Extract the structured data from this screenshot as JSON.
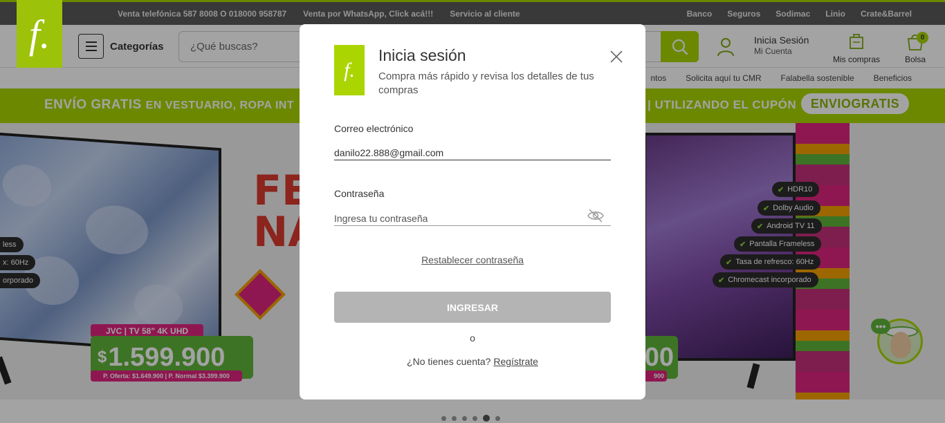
{
  "topbar": {
    "left_links": [
      "Venta telefónica 587 8008 O 018000 958787",
      "Venta por WhatsApp, Click acá!!!",
      "Servicio al cliente"
    ],
    "right_links": [
      "Banco",
      "Seguros",
      "Sodimac",
      "Linio",
      "Crate&Barrel"
    ]
  },
  "logo": {
    "glyph": "f."
  },
  "header": {
    "categories_label": "Categorías",
    "search_placeholder": "¿Qué buscas?",
    "user_title": "Inicia Sesión",
    "user_subtitle": "Mi Cuenta",
    "orders_label": "Mis compras",
    "bag_label": "Bolsa",
    "bag_count": "0"
  },
  "subnav": {
    "items": [
      "ntos",
      "Solicita aquí tu CMR",
      "Falabella sostenible",
      "Beneficios"
    ]
  },
  "promo": {
    "left_bold": "ENVÍO GRATIS",
    "left_rest": "EN VESTUARIO, ROPA INT",
    "right_text": "| UTILIZANDO EL CUPÓN",
    "coupon": "ENVIOGRATIS"
  },
  "banner": {
    "left_badges": [
      "less",
      "x: 60Hz",
      "orporado"
    ],
    "left_product": "JVC | TV 58\" 4K UHD",
    "left_price_symbol": "$",
    "left_price": "1.599.900",
    "left_offer": "P. Oferta: $1.649.900 | P. Normal $3.399.900",
    "feria_letters": [
      "FE",
      "NA"
    ],
    "right_badges": [
      "HDR10",
      "Dolby Audio",
      "Android TV 11",
      "Pantalla Frameless",
      "Tasa de refresco: 60Hz",
      "Chromecast incorporado"
    ],
    "right_price": "00",
    "right_offer": "900",
    "check_glyph": "✔",
    "chat_glyph": "•••"
  },
  "carousel": {
    "count": 6,
    "active": 5
  },
  "modal": {
    "logo_glyph": "f.",
    "title": "Inicia sesión",
    "subtitle": "Compra más rápido y revisa los detalles de tus compras",
    "email_label": "Correo electrónico",
    "email_value": "danilo22.888@gmail.com",
    "password_label": "Contraseña",
    "password_placeholder": "Ingresa tu contraseña",
    "reset_link": "Restablecer contraseña",
    "submit_label": "INGRESAR",
    "or_text": "o",
    "no_account_text": "¿No tienes cuenta?",
    "register_link": "Regístrate"
  },
  "colors": {
    "brand_green": "#aad500",
    "topbar_gray": "#5a5a5a",
    "accent_pink": "#e0257f",
    "disabled_button": "#b4b4b4"
  }
}
